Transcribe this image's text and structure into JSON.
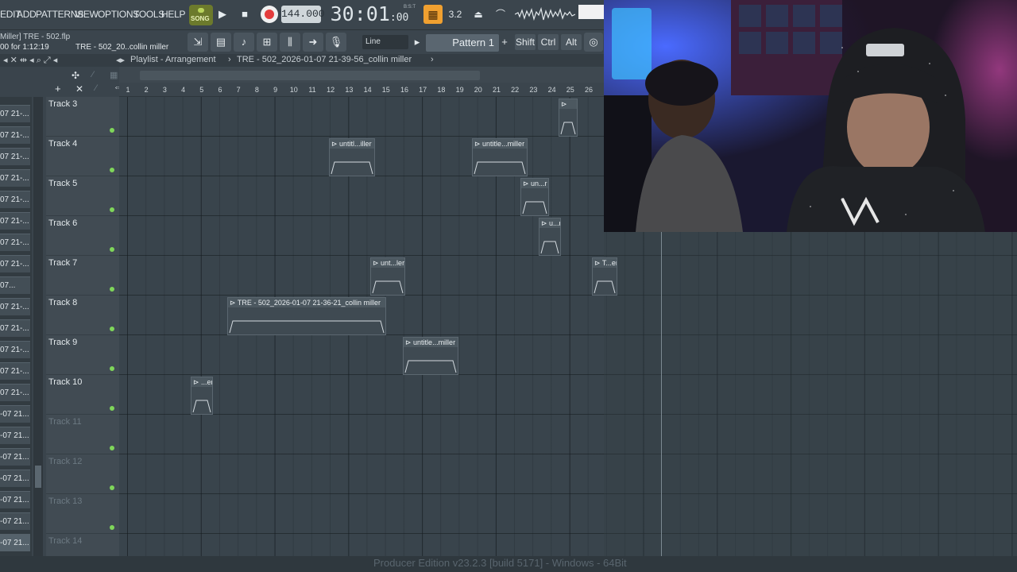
{
  "menu": [
    "EDIT",
    "ADD",
    "PATTERNS",
    "VIEW",
    "OPTIONS",
    "TOOLS",
    "HELP"
  ],
  "transport": {
    "song_label": "SONG",
    "tempo": "144.000",
    "time": "30:01",
    "time_sub": ":00",
    "time_label": "B:S:T",
    "cpu_label": "3.2"
  },
  "hint": {
    "line1": "Miller] TRE - 502.flp",
    "line2": "00 for 1:12:19",
    "line3": "TRE - 502_20..collin miller"
  },
  "toolbar": {
    "snap": "Line",
    "pattern": "Pattern 1",
    "shift": "Shift",
    "ctrl": "Ctrl",
    "alt": "Alt"
  },
  "playlist": {
    "title": "Playlist - Arrangement",
    "breadcrumb": "TRE - 502_2026-01-07 21-39-56_collin miller"
  },
  "ruler": [
    "1",
    "2",
    "3",
    "4",
    "5",
    "6",
    "7",
    "8",
    "9",
    "10",
    "11",
    "12",
    "13",
    "14",
    "15",
    "16",
    "17",
    "18",
    "19",
    "20",
    "21",
    "22",
    "23",
    "24",
    "25",
    "26"
  ],
  "picker": [
    "07 21-...",
    "07 21-...",
    "07 21-...",
    "07 21-...",
    "07 21-...",
    "07 21-...",
    "07 21-...",
    "07 21-...",
    "07...",
    "07 21-...",
    "07 21-...",
    "07 21-...",
    "07 21-...",
    "07 21-...",
    "-07 21...",
    "-07 21...",
    "-07 21...",
    "-07 21...",
    "-07 21...",
    "-07 21...",
    "-07 21..."
  ],
  "tracks": [
    "Track 3",
    "Track 4",
    "Track 5",
    "Track 6",
    "Track 7",
    "Track 8",
    "Track 9",
    "Track 10",
    "Track 11",
    "Track 12",
    "Track 13",
    "Track 14"
  ],
  "clips": [
    {
      "label": "",
      "track": "Track 3"
    },
    {
      "label": "untitl...iller",
      "track": "Track 4"
    },
    {
      "label": "untitle...miller",
      "track": "Track 4"
    },
    {
      "label": "un...r",
      "track": "Track 5"
    },
    {
      "label": "u...r",
      "track": "Track 6"
    },
    {
      "label": "unt...ler",
      "track": "Track 7"
    },
    {
      "label": "T...er",
      "track": "Track 7"
    },
    {
      "label": "TRE - 502_2026-01-07 21-36-21_collin miller",
      "track": "Track 8"
    },
    {
      "label": "untitle...miller",
      "track": "Track 9"
    },
    {
      "label": "...er",
      "track": "Track 10"
    }
  ],
  "footer": "Producer Edition v23.2.3 [build 5171] - Windows - 64Bit"
}
